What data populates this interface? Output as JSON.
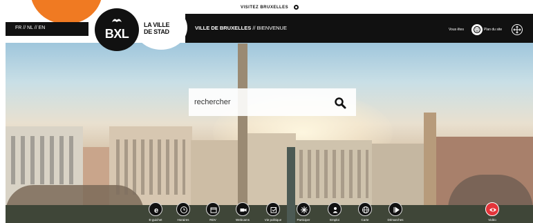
{
  "header": {
    "visit_label": "VISITEZ BRUXELLES",
    "languages": "FR // NL // EN",
    "logo_text": "BXL",
    "ville_line1": "LA VILLE",
    "ville_line2": "DE STAD",
    "nav_title_main": "VILLE DE BRUXELLES",
    "nav_title_sep": " // BIENVENUE",
    "vous_etes": "Vous êtes",
    "plan_du_site": "Plan du site"
  },
  "search": {
    "placeholder": "rechercher"
  },
  "toolbar": {
    "items": [
      {
        "label": "E-guichet",
        "icon": "e-icon"
      },
      {
        "label": "Horaires",
        "icon": "clock-icon"
      },
      {
        "label": "RDV",
        "icon": "calendar-icon"
      },
      {
        "label": "Webcams",
        "icon": "camera-icon"
      },
      {
        "label": "Vie politique",
        "icon": "ballot-icon"
      },
      {
        "label": "Participer",
        "icon": "sparkle-icon"
      },
      {
        "label": "Emploi",
        "icon": "person-icon"
      },
      {
        "label": "Carte",
        "icon": "globe-icon"
      },
      {
        "label": "Démarches",
        "icon": "play-icon"
      },
      {
        "label": "Vidéo",
        "icon": "eye-icon"
      }
    ]
  },
  "colors": {
    "accent": "#f07a22",
    "dark": "#111111",
    "video": "#e4343a"
  }
}
